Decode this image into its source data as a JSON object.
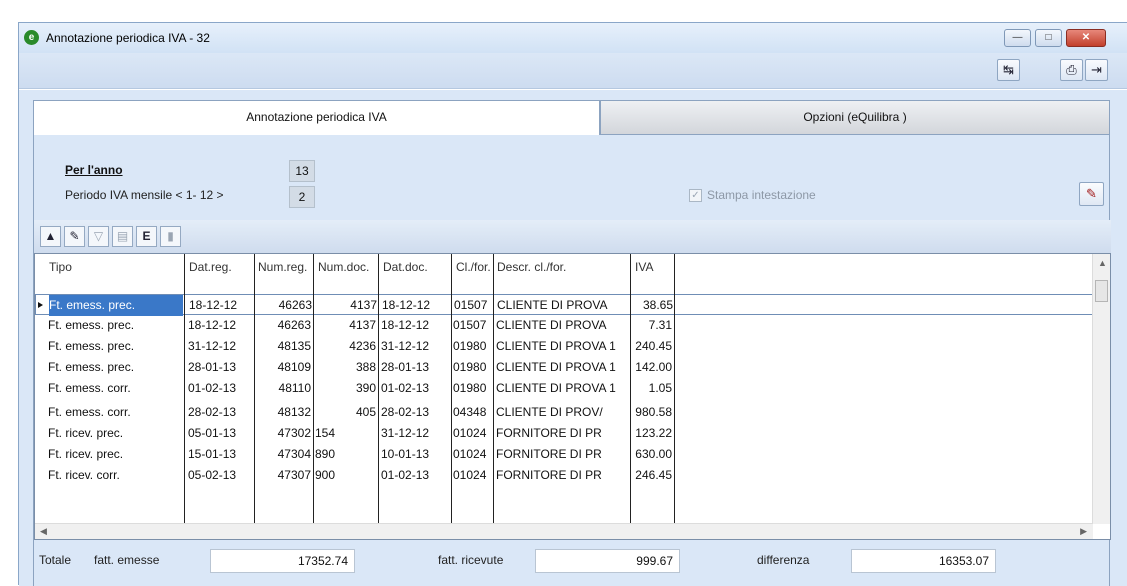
{
  "window": {
    "title": "Annotazione periodica IVA - 32",
    "controls": {
      "minimize": "—",
      "maximize": "□",
      "close": "✕"
    }
  },
  "toolbar": {
    "refresh_icon": "↹",
    "print_icon": "⎙",
    "exit_icon": "⇥"
  },
  "tabs": [
    {
      "label": "Annotazione periodica IVA",
      "active": true
    },
    {
      "label": "Opzioni (eQuilibra )",
      "active": false
    }
  ],
  "form": {
    "year_label": "Per l'anno",
    "year_value": "13",
    "period_label": "Periodo IVA mensile < 1- 12 >",
    "period_value": "2",
    "print_header_label": "Stampa intestazione",
    "print_header_checked": true
  },
  "grid_toolbar": {
    "buttons": [
      "▲",
      "✎",
      "▽",
      "▤",
      "E",
      "▮"
    ]
  },
  "table": {
    "columns": [
      "Tipo",
      "Dat.reg.",
      "Num.reg.",
      "Num.doc.",
      "Dat.doc.",
      "Cl./for.",
      "Descr. cl./for.",
      "IVA"
    ],
    "rows": [
      [
        "Ft. emess. prec.",
        "18-12-12",
        "46263",
        "4137",
        "18-12-12",
        "01507",
        "CLIENTE DI PROVA",
        "38.65"
      ],
      [
        "Ft. emess. prec.",
        "18-12-12",
        "46263",
        "4137",
        "18-12-12",
        "01507",
        "CLIENTE DI PROVA",
        "7.31"
      ],
      [
        "Ft. emess. prec.",
        "31-12-12",
        "48135",
        "4236",
        "31-12-12",
        "01980",
        "CLIENTE DI PROVA 1",
        "240.45"
      ],
      [
        "Ft. emess. prec.",
        "28-01-13",
        "48109",
        "388",
        "28-01-13",
        "01980",
        "CLIENTE DI PROVA 1",
        "142.00"
      ],
      [
        "Ft. emess. corr.",
        "01-02-13",
        "48110",
        "390",
        "01-02-13",
        "01980",
        "CLIENTE DI PROVA 1",
        "1.05"
      ],
      [
        "Ft. emess. corr.",
        "28-02-13",
        "48132",
        "405",
        "28-02-13",
        "04348",
        "CLIENTE DI PROV/",
        "980.58"
      ],
      [
        "Ft. ricev. prec.",
        "05-01-13",
        "47302",
        "154",
        "31-12-12",
        "01024",
        "FORNITORE DI PR",
        "123.22"
      ],
      [
        "Ft. ricev. prec.",
        "15-01-13",
        "47304",
        "890",
        "10-01-13",
        "01024",
        "FORNITORE DI PR",
        "630.00"
      ],
      [
        "Ft. ricev. corr.",
        "05-02-13",
        "47307",
        "900",
        "01-02-13",
        "01024",
        "FORNITORE DI PR",
        "246.45"
      ]
    ]
  },
  "totals": {
    "label": "Totale",
    "emitted_label": "fatt. emesse",
    "emitted_value": "17352.74",
    "received_label": "fatt. ricevute",
    "received_value": "999.67",
    "difference_label": "differenza",
    "difference_value": "16353.07"
  },
  "colors": {
    "panel_bg": "#dae7f7",
    "accent": "#6f8db5"
  }
}
